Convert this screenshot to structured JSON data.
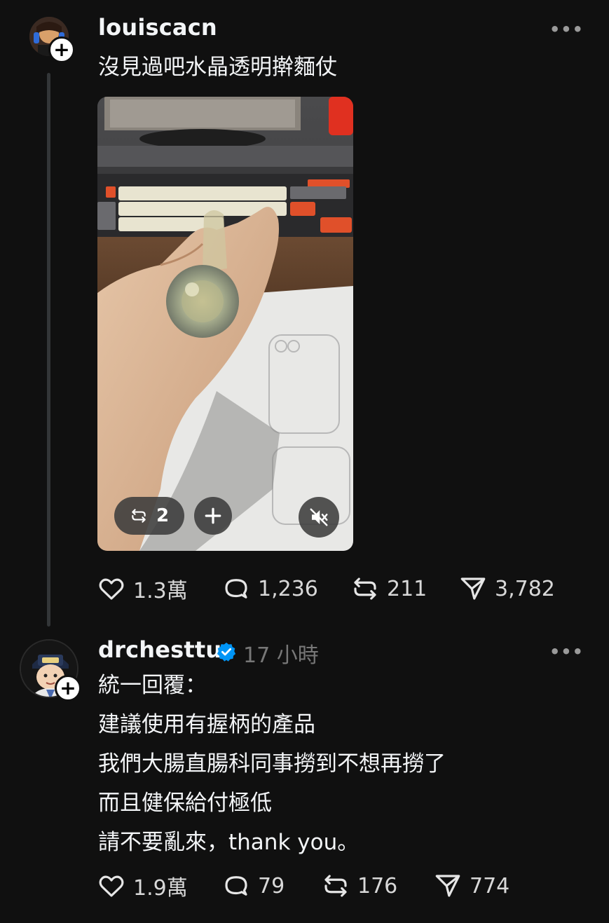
{
  "posts": [
    {
      "username": "louiscacn",
      "text": "沒見過吧水晶透明擀麵仗",
      "media": {
        "repost_count": "2",
        "icons": [
          "repost-icon",
          "plus-icon",
          "mute-icon"
        ]
      },
      "stats": {
        "likes": "1.3萬",
        "comments": "1,236",
        "reposts": "211",
        "shares": "3,782"
      }
    },
    {
      "username": "drchesttu",
      "verified": true,
      "time": "17 小時",
      "lines": [
        "統一回覆：",
        "建議使用有握柄的產品",
        "我們大腸直腸科同事撈到不想再撈了",
        "而且健保給付極低",
        "請不要亂來，thank you。"
      ],
      "stats": {
        "likes": "1.9萬",
        "comments": "79",
        "reposts": "176",
        "shares": "774"
      }
    }
  ],
  "colors": {
    "background": "#101010",
    "text": "#f3f5f7",
    "muted": "#777777",
    "verified": "#0095f6"
  }
}
